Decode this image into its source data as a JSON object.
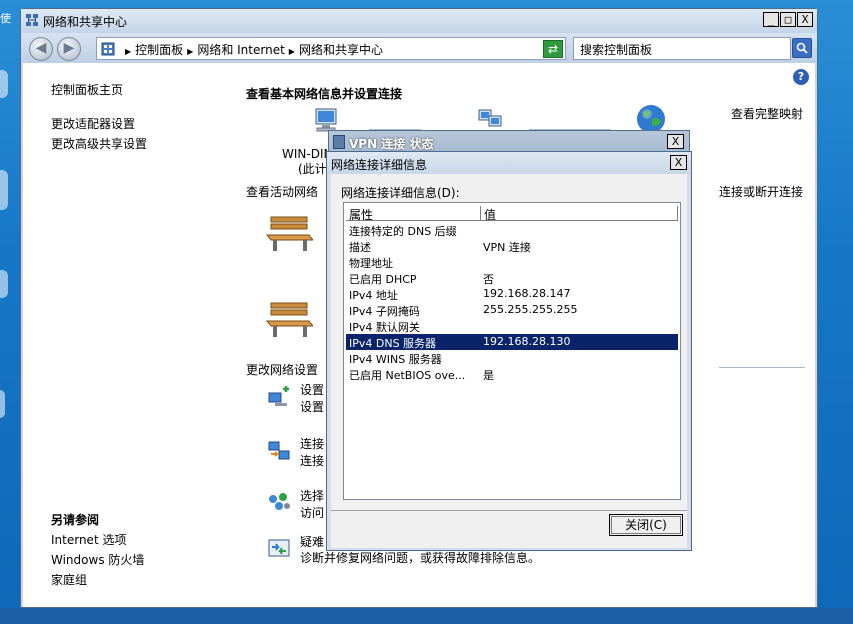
{
  "desktop": {
    "side_text": "使"
  },
  "window": {
    "title": "网络和共享中心",
    "controls": {
      "minimize": "_",
      "maximize": "□",
      "close": "X"
    }
  },
  "navbar": {
    "back": "◀",
    "forward": "▶",
    "breadcrumb": [
      "控制面板",
      "网络和 Internet",
      "网络和共享中心"
    ],
    "search_placeholder": "搜索控制面板"
  },
  "sidebar": {
    "links": [
      "控制面板主页",
      "更改适配器设置",
      "更改高级共享设置"
    ],
    "see_also_title": "另请参阅",
    "see_also_links": [
      "Internet 选项",
      "Windows 防火墙",
      "家庭组"
    ]
  },
  "main": {
    "heading": "查看基本网络信息并设置连接",
    "full_map_link": "查看完整映射",
    "computer_label": "WIN-DIM",
    "computer_sub": "(此计",
    "active_networks_label": "查看活动网络",
    "connect_disconnect_link": "连接或断开连接",
    "change_settings_label": "更改网络设置",
    "tasks": [
      {
        "line1": "设置",
        "line2": "设置"
      },
      {
        "line1": "连接",
        "line2": "连接"
      },
      {
        "line1": "选择",
        "line2": "访问"
      },
      {
        "line1": "疑难",
        "line2": "诊断并修复网络问题，或获得故障排除信息。"
      }
    ]
  },
  "vpn_status_dialog": {
    "title": "VPN 连接 状态",
    "close": "X"
  },
  "details_dialog": {
    "title": "网络连接详细信息",
    "close": "X",
    "list_label": "网络连接详细信息(D):",
    "columns": [
      "属性",
      "值"
    ],
    "rows": [
      {
        "property": "连接特定的 DNS 后缀",
        "value": ""
      },
      {
        "property": "描述",
        "value": "VPN 连接"
      },
      {
        "property": "物理地址",
        "value": ""
      },
      {
        "property": "已启用 DHCP",
        "value": "否"
      },
      {
        "property": "IPv4 地址",
        "value": "192.168.28.147"
      },
      {
        "property": "IPv4 子网掩码",
        "value": "255.255.255.255"
      },
      {
        "property": "IPv4 默认网关",
        "value": ""
      },
      {
        "property": "IPv4 DNS 服务器",
        "value": "192.168.28.130"
      },
      {
        "property": "IPv4 WINS 服务器",
        "value": ""
      },
      {
        "property": "已启用 NetBIOS ove...",
        "value": "是"
      }
    ],
    "selected_row": 7,
    "close_button": "关闭(C)"
  }
}
